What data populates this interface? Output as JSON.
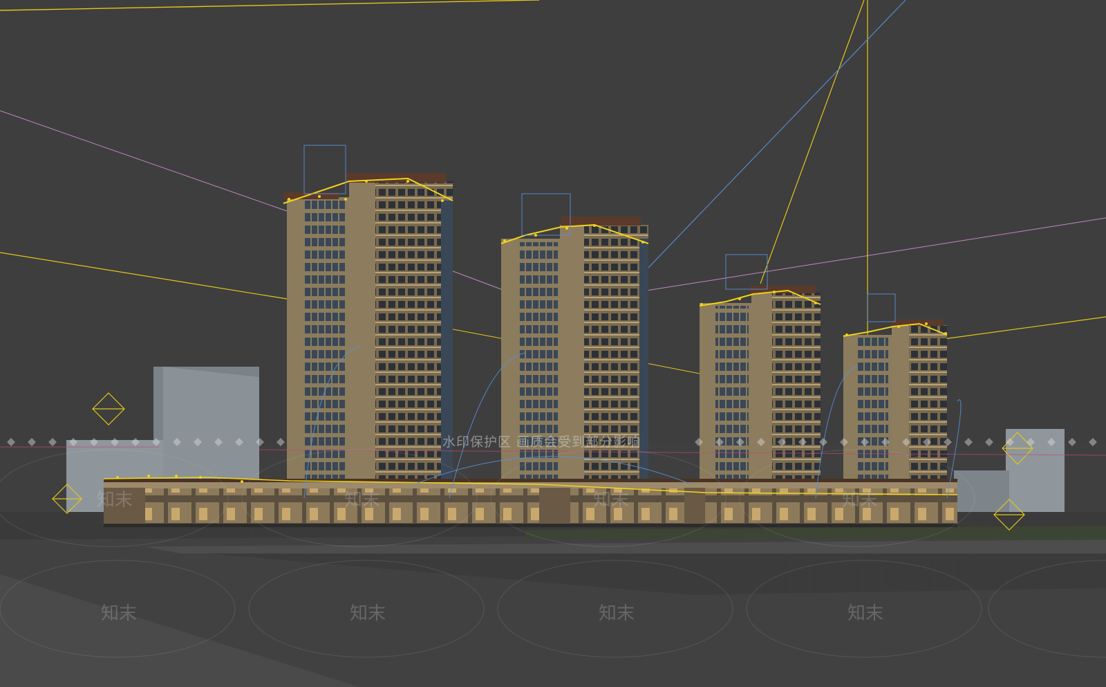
{
  "viewport": {
    "background": "#3f3f3f",
    "selection_color": "#f2d31a",
    "camera_line_color": "#5b8fd6",
    "guide_line_color": "#c08ac0"
  },
  "watermark": {
    "text": "水印保护区 画质会受到部分影响",
    "logo_text": "知末"
  },
  "icons": [
    "light-diamond-icon",
    "watermark-diamond-icon"
  ]
}
